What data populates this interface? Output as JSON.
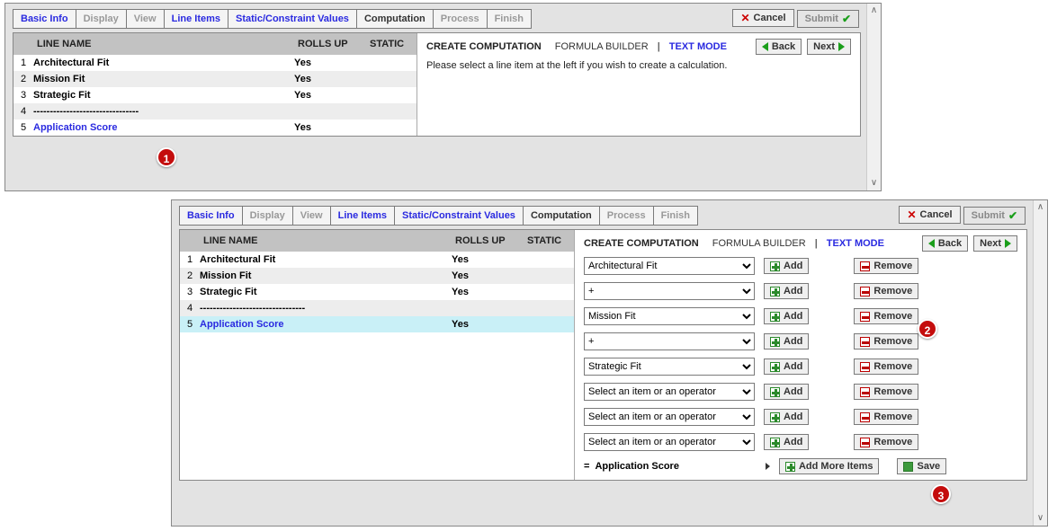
{
  "tabs": [
    "Basic Info",
    "Display",
    "View",
    "Line Items",
    "Static/Constraint Values",
    "Computation",
    "Process",
    "Finish"
  ],
  "tab_disabled": [
    false,
    true,
    true,
    false,
    false,
    false,
    true,
    true
  ],
  "tab_active_index": 5,
  "cancel_label": "Cancel",
  "submit_label": "Submit",
  "back_label": "Back",
  "next_label": "Next",
  "grid": {
    "header_name": "LINE NAME",
    "header_rollsup": "ROLLS UP",
    "header_static": "STATIC",
    "rows": [
      {
        "num": "1",
        "name": "Architectural Fit",
        "rollsup": "Yes",
        "link": false
      },
      {
        "num": "2",
        "name": "Mission Fit",
        "rollsup": "Yes",
        "link": false
      },
      {
        "num": "3",
        "name": "Strategic Fit",
        "rollsup": "Yes",
        "link": false
      },
      {
        "num": "4",
        "name": "--------------------------------",
        "rollsup": "",
        "link": false
      },
      {
        "num": "5",
        "name": "Application Score",
        "rollsup": "Yes",
        "link": true
      }
    ]
  },
  "right_panel": {
    "title": "CREATE COMPUTATION",
    "builder_label": "FORMULA BUILDER",
    "text_mode_label": "TEXT MODE",
    "hint": "Please select a line item at the left if you wish to create a calculation."
  },
  "add_label": "Add",
  "remove_label": "Remove",
  "add_more_label": "Add More Items",
  "save_label": "Save",
  "equals_prefix": "=",
  "equals_target": "Application Score",
  "formula_rows": [
    "Architectural Fit",
    "+",
    "Mission Fit",
    "+",
    "Strategic Fit",
    "Select an item or an operator",
    "Select an item or an operator",
    "Select an item or an operator"
  ],
  "markers": {
    "m1": "1",
    "m2": "2",
    "m3": "3"
  }
}
